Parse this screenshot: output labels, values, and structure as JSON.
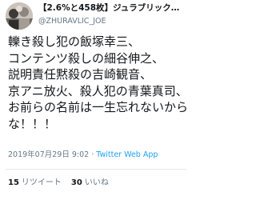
{
  "tweet": {
    "display_name": "【2.6%と458枚】ジュラブリック…",
    "handle": "@ZHURAVLIC_JOE",
    "body_lines": [
      "轢き殺し犯の飯塚幸三、",
      "コンテンツ殺しの細谷伸之、",
      "説明責任黙殺の吉崎観音、",
      "京アニ放火、殺人犯の青葉真司、",
      "お前らの名前は一生忘れないから",
      "な！！！"
    ],
    "timestamp": "2019年07月29日 9:02",
    "separator": "·",
    "source": "Twitter Web App",
    "retweets_count": "15",
    "retweets_label": "リツイート",
    "likes_count": "30",
    "likes_label": "いいね"
  },
  "colors": {
    "text": "#14171a",
    "secondary": "#657786",
    "link": "#1da1f2",
    "divider": "#e1e8ed"
  },
  "icons": {
    "avatar": "avatar-image"
  }
}
